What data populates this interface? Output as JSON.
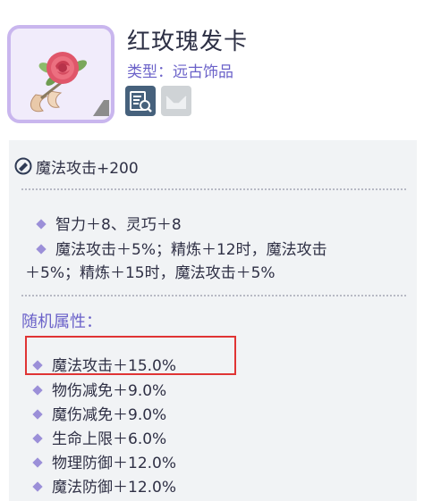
{
  "item": {
    "name": "红玫瑰发卡",
    "type_label": "类型：远古饰品",
    "icon": "red-rose-hairpin"
  },
  "actions": {
    "detail_icon": "item-detail-search-icon",
    "mail_icon": "mail-icon"
  },
  "refine": {
    "icon": "magic-orb-icon",
    "text": "魔法攻击+200"
  },
  "base_stats": {
    "line1": "智力＋8、灵巧＋8",
    "line2": "魔法攻击＋5%；精炼＋12时，魔法攻击",
    "line3": "＋5%；精炼＋15时，魔法攻击＋5%"
  },
  "random": {
    "title": "随机属性：",
    "items": [
      "魔法攻击＋15.0%",
      "物伤减免＋9.0%",
      "魔伤减免＋9.0%",
      "生命上限＋6.0%",
      "物理防御＋12.0%",
      "魔法防御＋12.0%"
    ]
  },
  "colors": {
    "accent": "#6b62c9",
    "highlight_border": "#e03434",
    "panel_bg": "#f1f3f5",
    "icon_frame": "#c9b6ee"
  }
}
